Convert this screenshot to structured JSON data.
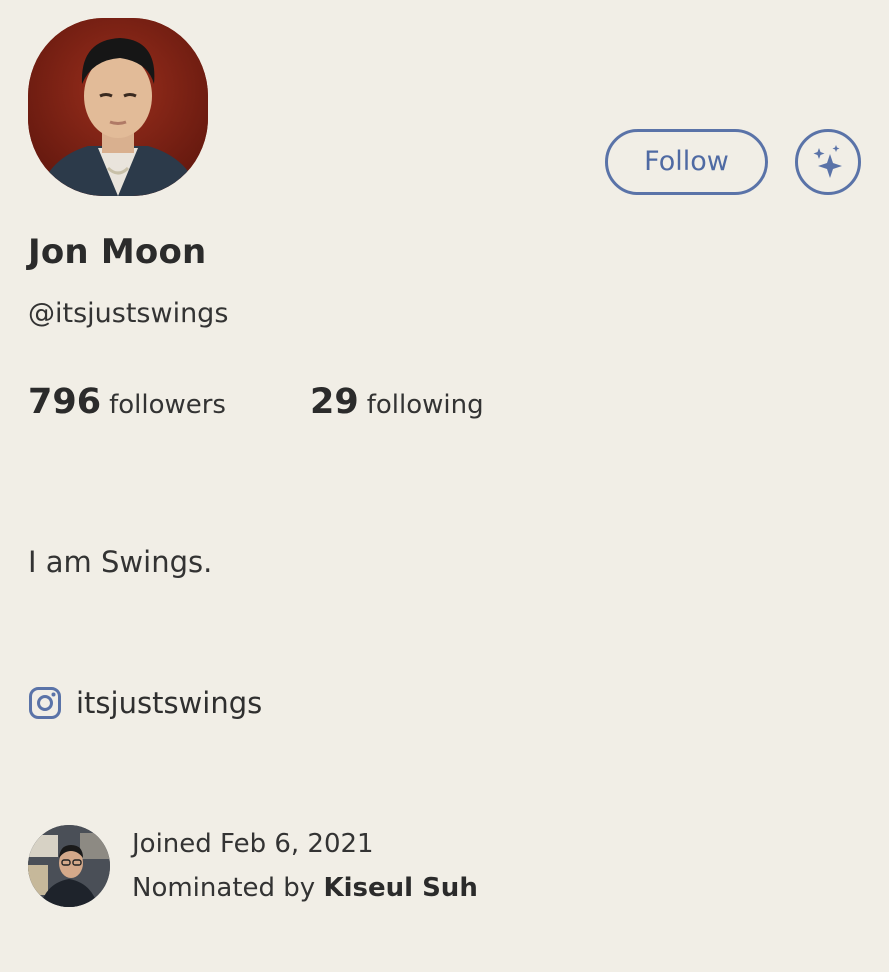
{
  "profile": {
    "name": "Jon Moon",
    "handle": "@itsjustswings",
    "bio": "I am Swings."
  },
  "stats": {
    "followers_count": "796",
    "followers_label": "followers",
    "following_count": "29",
    "following_label": "following"
  },
  "actions": {
    "follow_label": "Follow",
    "sparkle_icon": "sparkle-icon"
  },
  "social": {
    "instagram_icon": "instagram-icon",
    "instagram_handle": "itsjustswings"
  },
  "meta": {
    "joined_text": "Joined Feb 6, 2021",
    "nominated_prefix": "Nominated by",
    "nominator_name": "Kiseul Suh"
  },
  "colors": {
    "background": "#f1eee6",
    "accent": "#5a73a8",
    "text": "#2b2b2b"
  }
}
